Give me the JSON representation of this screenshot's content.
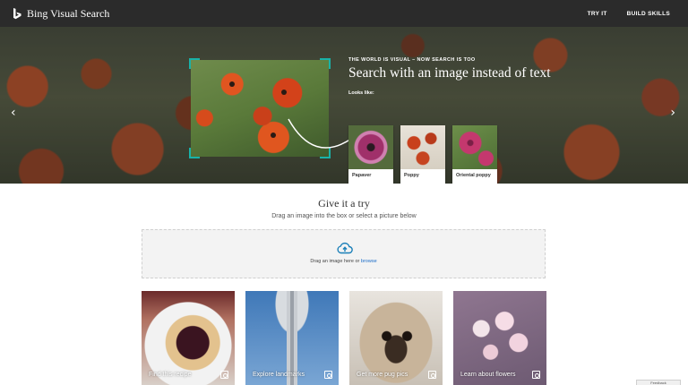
{
  "header": {
    "brand": "Bing Visual Search",
    "nav": [
      {
        "label": "TRY IT"
      },
      {
        "label": "BUILD SKILLS"
      }
    ]
  },
  "hero": {
    "kicker": "THE WORLD IS VISUAL – NOW SEARCH IS TOO",
    "title": "Search with an image instead of text",
    "looks_like": "Looks like:",
    "prev_icon": "chevron-left-icon",
    "next_icon": "chevron-right-icon",
    "results": [
      {
        "label": "Papaver"
      },
      {
        "label": "Poppy"
      },
      {
        "label": "Oriental poppy"
      }
    ]
  },
  "try": {
    "title": "Give it a try",
    "subtitle": "Drag an image into the box or select a picture below",
    "drop_text": "Drag an image here or",
    "browse": "browse",
    "upload_icon": "cloud-upload-icon"
  },
  "samples": [
    {
      "label": "Find this recipe"
    },
    {
      "label": "Explore landmarks"
    },
    {
      "label": "Get more pug pics"
    },
    {
      "label": "Learn about flowers"
    }
  ],
  "feedback": "Feedback",
  "colors": {
    "topbar": "#2b2b2b",
    "accent": "#19b2a8",
    "link": "#1a6cc8"
  }
}
